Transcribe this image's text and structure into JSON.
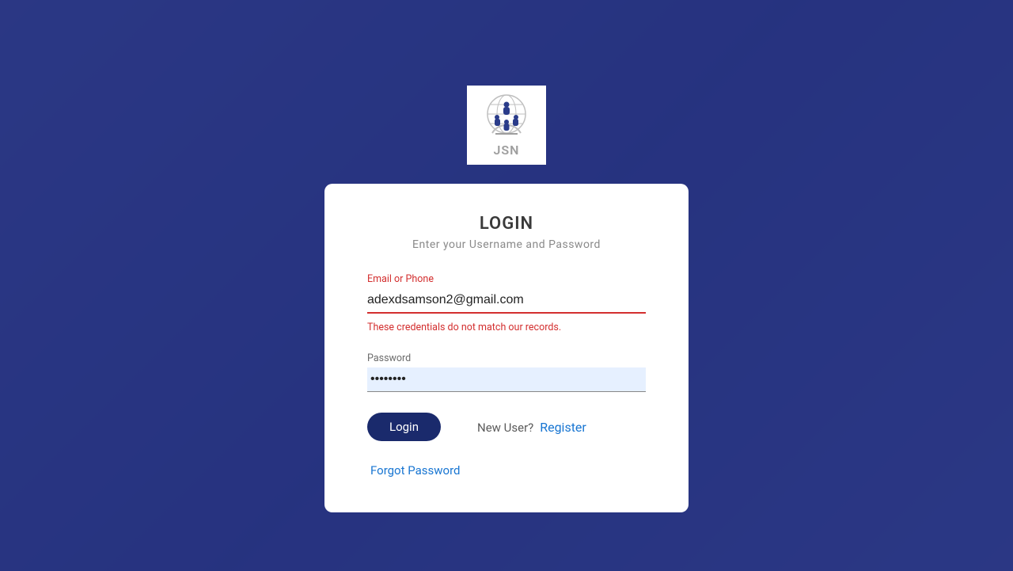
{
  "logo": {
    "text": "JSN"
  },
  "card": {
    "title": "LOGIN",
    "subtitle": "Enter your Username and Password"
  },
  "fields": {
    "email": {
      "label": "Email or Phone",
      "value": "adexdsamson2@gmail.com",
      "error": "These credentials do not match our records."
    },
    "password": {
      "label": "Password",
      "value": "••••••••"
    }
  },
  "actions": {
    "login_label": "Login",
    "new_user_text": "New User?",
    "register_label": "Register",
    "forgot_label": "Forgot Password"
  }
}
